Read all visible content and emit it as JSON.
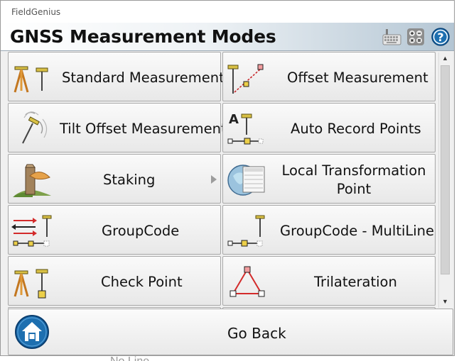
{
  "window": {
    "title": "FieldGenius"
  },
  "header": {
    "title": "GNSS Measurement Modes"
  },
  "toolbar": {
    "keyboard_icon": "keyboard-icon",
    "calculator_icon": "calculator-icon",
    "help_icon": "help-icon"
  },
  "modes": [
    {
      "label": "Standard Measurement",
      "icon": "tripod-rod-icon"
    },
    {
      "label": "Offset Measurement",
      "icon": "offset-icon"
    },
    {
      "label": "Tilt Offset Measurement",
      "icon": "tilt-rod-icon"
    },
    {
      "label": "Auto Record Points",
      "icon": "auto-record-icon"
    },
    {
      "label": "Staking",
      "icon": "stake-icon"
    },
    {
      "label": "Local Transformation Point",
      "icon": "transformation-icon"
    },
    {
      "label": "GroupCode",
      "icon": "groupcode-icon"
    },
    {
      "label": "GroupCode - MultiLine",
      "icon": "groupcode-multiline-icon"
    },
    {
      "label": "Check Point",
      "icon": "check-point-icon"
    },
    {
      "label": "Trilateration",
      "icon": "trilateration-icon"
    }
  ],
  "footer": {
    "go_back_label": "Go Back",
    "home_icon": "home-icon"
  },
  "colors": {
    "header_gradient_end": "#b4c6d4",
    "accent_blue": "#1d6fb0",
    "rod_yellow": "#e2cf4a",
    "node_red": "#c8262a"
  }
}
